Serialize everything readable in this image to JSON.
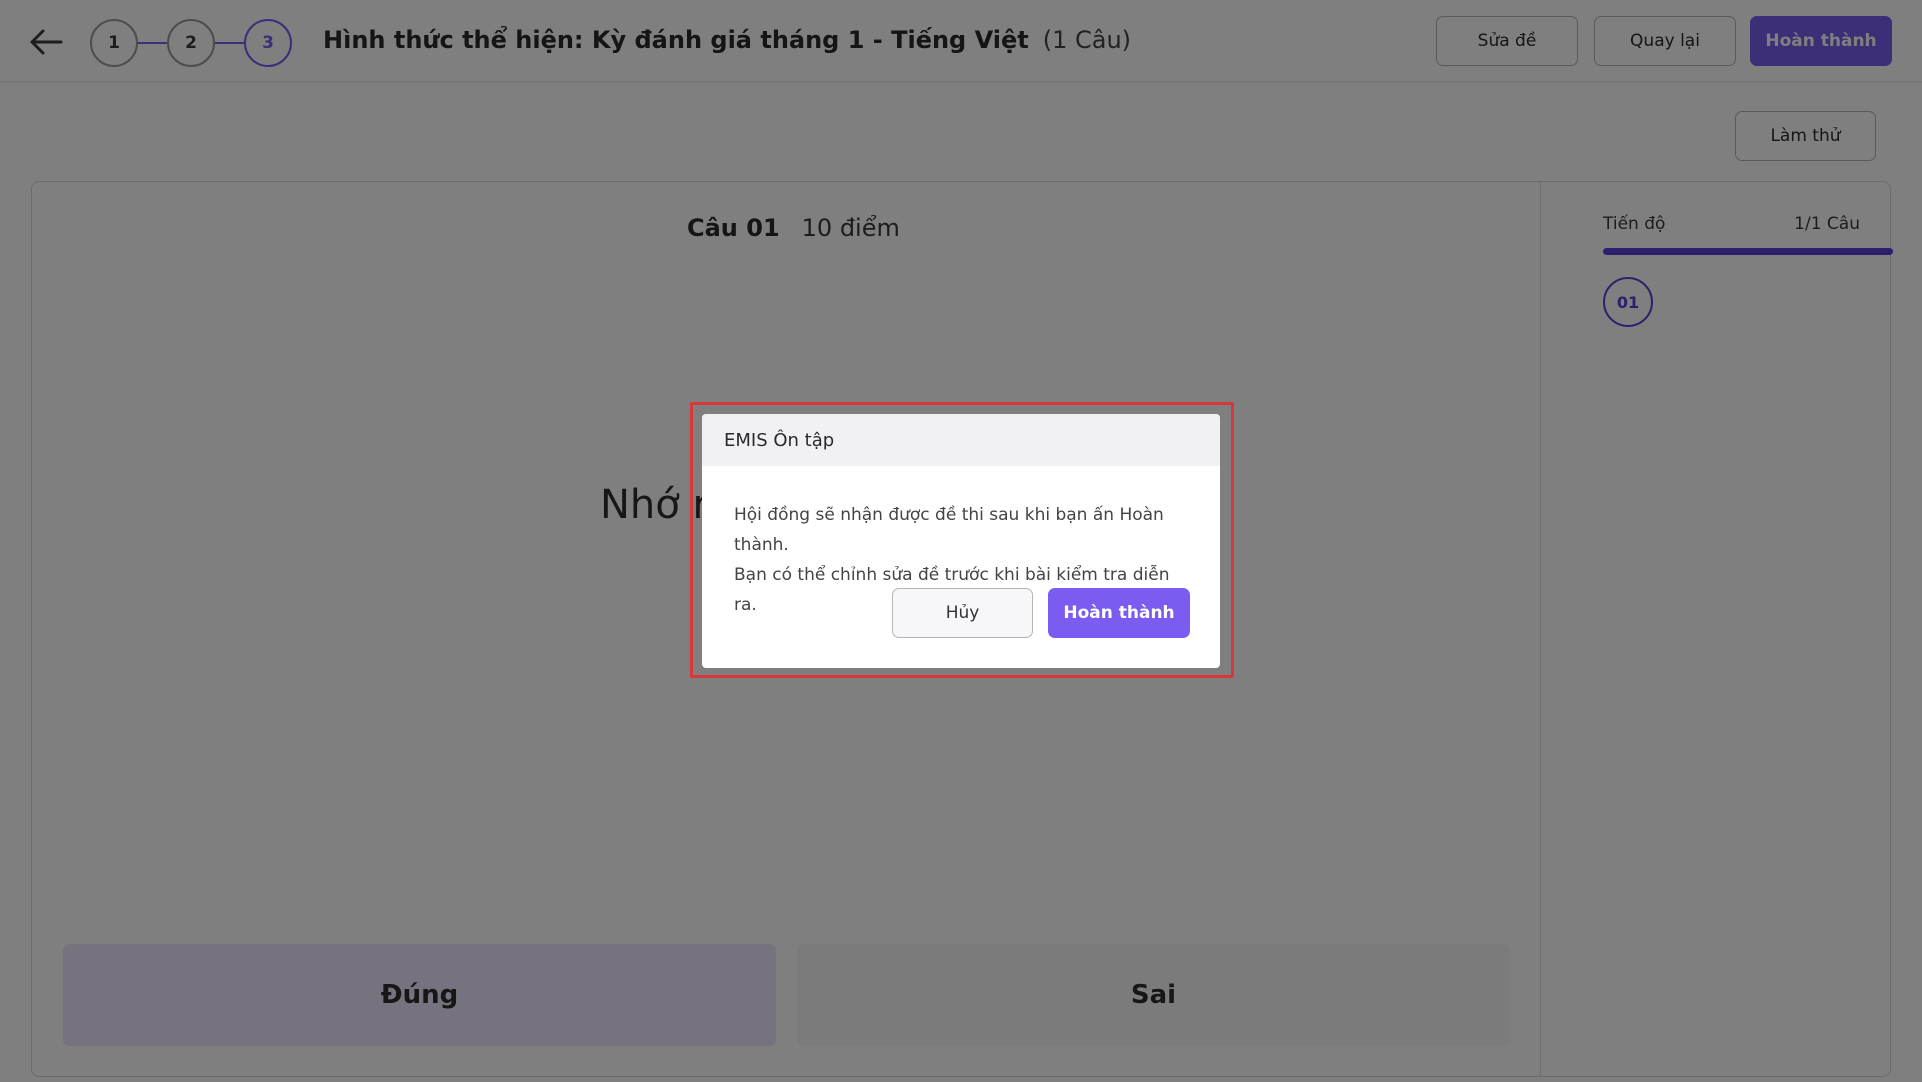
{
  "header": {
    "back_icon": "arrow-left-icon",
    "steps": [
      "1",
      "2",
      "3"
    ],
    "active_step": "3",
    "title": "Hình thức thể hiện: Kỳ đánh giá tháng 1 - Tiếng Việt",
    "question_count": "(1 Câu)",
    "edit_label": "Sửa đề",
    "back_label": "Quay lại",
    "done_label": "Hoàn thành"
  },
  "toolbar": {
    "try_label": "Làm thử"
  },
  "question": {
    "number": "Câu 01",
    "points": "10 điểm",
    "text_visible": "Nhớ r",
    "answers": [
      "Đúng",
      "Sai"
    ]
  },
  "progress": {
    "label": "Tiến độ",
    "count": "1/1 Câu",
    "fraction": 1.0,
    "bubbles": [
      "01"
    ]
  },
  "dialog": {
    "title": "EMIS Ôn tập",
    "line1": "Hội đồng sẽ nhận được đề thi sau khi bạn ấn Hoàn thành.",
    "line2": "Bạn có thể chỉnh sửa đề trước khi bài kiểm tra diễn ra.",
    "cancel_label": "Hủy",
    "confirm_label": "Hoàn thành"
  },
  "colors": {
    "accent": "#7b5cf0",
    "accent_dark": "#5b3fd6",
    "highlight": "#d93838"
  }
}
